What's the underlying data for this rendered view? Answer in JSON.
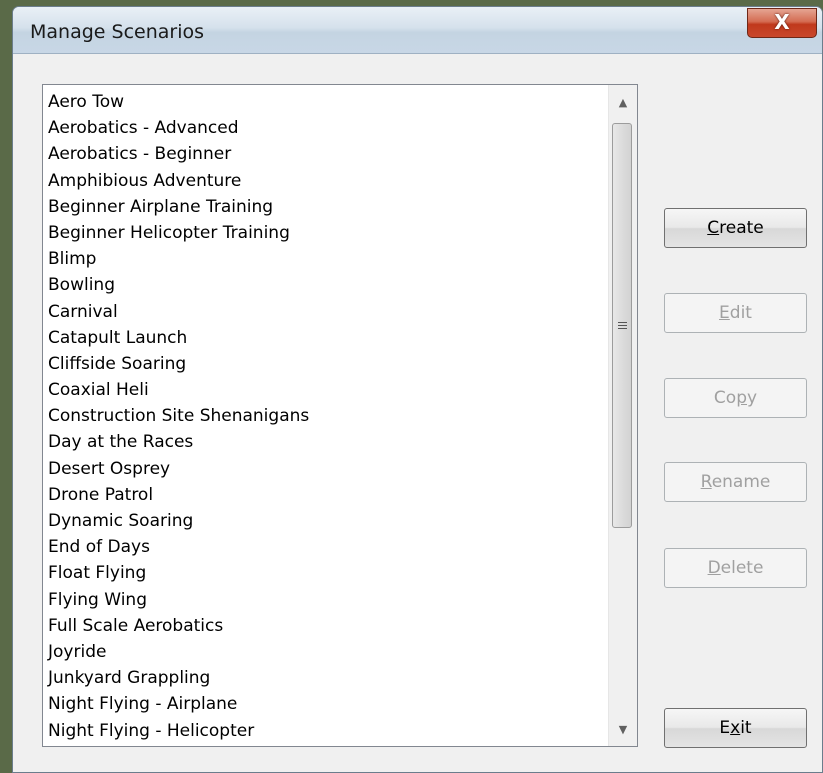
{
  "window": {
    "title": "Manage Scenarios",
    "close_glyph": "X"
  },
  "scenarios": [
    "Aero Tow",
    "Aerobatics - Advanced",
    "Aerobatics - Beginner",
    "Amphibious Adventure",
    "Beginner Airplane Training",
    "Beginner Helicopter Training",
    "Blimp",
    "Bowling",
    "Carnival",
    "Catapult Launch",
    "Cliffside Soaring",
    "Coaxial Heli",
    "Construction Site Shenanigans",
    "Day at the Races",
    "Desert Osprey",
    "Drone Patrol",
    "Dynamic Soaring",
    "End of Days",
    "Float Flying",
    "Flying Wing",
    "Full Scale Aerobatics",
    "Joyride",
    "Junkyard Grappling",
    "Night Flying - Airplane",
    "Night Flying - Helicopter"
  ],
  "buttons": {
    "create": {
      "pre": "",
      "key": "C",
      "post": "reate",
      "enabled": true
    },
    "edit": {
      "pre": "",
      "key": "E",
      "post": "dit",
      "enabled": false
    },
    "copy": {
      "pre": "Co",
      "key": "p",
      "post": "y",
      "enabled": false
    },
    "rename": {
      "pre": "",
      "key": "R",
      "post": "ename",
      "enabled": false
    },
    "delete": {
      "pre": "",
      "key": "D",
      "post": "elete",
      "enabled": false
    },
    "exit": {
      "pre": "E",
      "key": "x",
      "post": "it",
      "enabled": true
    }
  },
  "icons": {
    "scroll_up": "scroll-up-arrow-icon",
    "scroll_down": "scroll-down-arrow-icon",
    "thumb_grip": "scroll-grip-icon"
  }
}
